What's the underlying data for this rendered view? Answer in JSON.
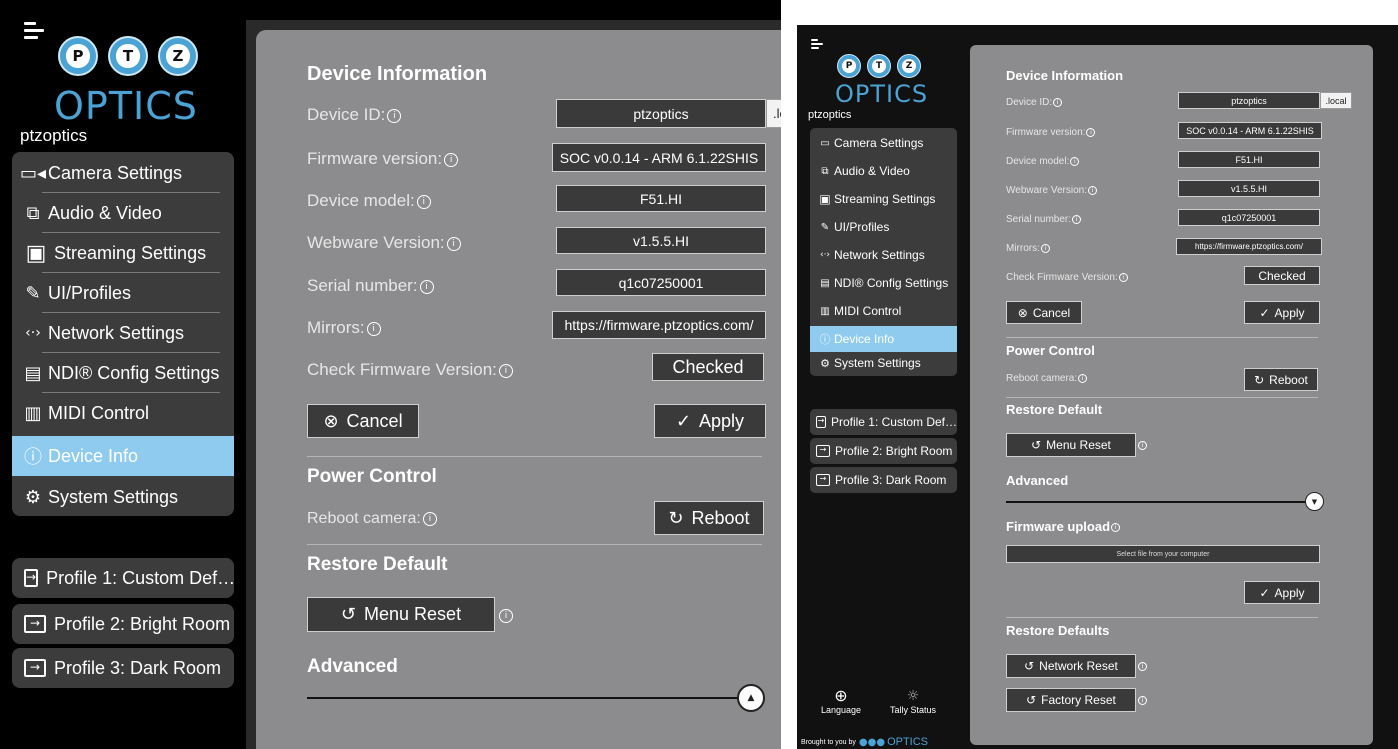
{
  "brand": {
    "logo_letters": [
      "P",
      "T",
      "Z"
    ],
    "logo_word": "OPTICS",
    "device_name": "ptzoptics"
  },
  "menu": [
    {
      "label": "Camera Settings",
      "icon": "video-camera-icon",
      "glyph": "▭"
    },
    {
      "label": "Audio & Video",
      "icon": "audio-video-icon",
      "glyph": "⧉"
    },
    {
      "label": "Streaming Settings",
      "icon": "streaming-icon",
      "glyph": "▣"
    },
    {
      "label": "UI/Profiles",
      "icon": "palette-icon",
      "glyph": "✎"
    },
    {
      "label": "Network Settings",
      "icon": "network-icon",
      "glyph": "‹·›"
    },
    {
      "label": "NDI® Config Settings",
      "icon": "ndi-icon",
      "glyph": "▤"
    },
    {
      "label": "MIDI Control",
      "icon": "midi-icon",
      "glyph": "▥"
    },
    {
      "label": "Device Info",
      "icon": "info-circle-icon",
      "glyph": "ⓘ",
      "active": true
    },
    {
      "label": "System Settings",
      "icon": "gear-icon",
      "glyph": "⚙"
    }
  ],
  "profiles": [
    {
      "label": "Profile 1: Custom Def…"
    },
    {
      "label": "Profile 2: Bright Room"
    },
    {
      "label": "Profile 3: Dark Room"
    }
  ],
  "device_info": {
    "title": "Device Information",
    "rows": [
      {
        "label": "Device ID:",
        "value": "ptzoptics",
        "suffix": ".local",
        "suffix_cut": ".lc"
      },
      {
        "label": "Firmware version:",
        "value": "SOC v0.0.14 - ARM 6.1.22SHIS"
      },
      {
        "label": "Device model:",
        "value": "F51.HI"
      },
      {
        "label": "Webware Version:",
        "value": "v1.5.5.HI"
      },
      {
        "label": "Serial number:",
        "value": "q1c07250001"
      },
      {
        "label": "Mirrors:",
        "value": "https://firmware.ptzoptics.com/"
      }
    ],
    "check_firmware": {
      "label": "Check Firmware Version:",
      "button": "Checked"
    },
    "cancel": "Cancel",
    "apply": "Apply"
  },
  "power": {
    "title": "Power Control",
    "label": "Reboot camera:",
    "button": "Reboot"
  },
  "restore": {
    "title": "Restore Default",
    "button": "Menu Reset"
  },
  "advanced": {
    "title": "Advanced"
  },
  "firmware_upload": {
    "title": "Firmware upload",
    "placeholder": "Select file from your computer",
    "apply": "Apply"
  },
  "restore_defaults": {
    "title": "Restore Defaults",
    "network_reset": "Network Reset",
    "factory_reset": "Factory Reset"
  },
  "footer": {
    "language": "Language",
    "tally": "Tally Status",
    "brought_by": "Brought to you by",
    "brand_word": "OPTICS"
  },
  "colors": {
    "accent": "#8fcbee",
    "panel": "#8c8c8e",
    "menu": "#3c3c3c",
    "logo": "#4aa3d4"
  }
}
